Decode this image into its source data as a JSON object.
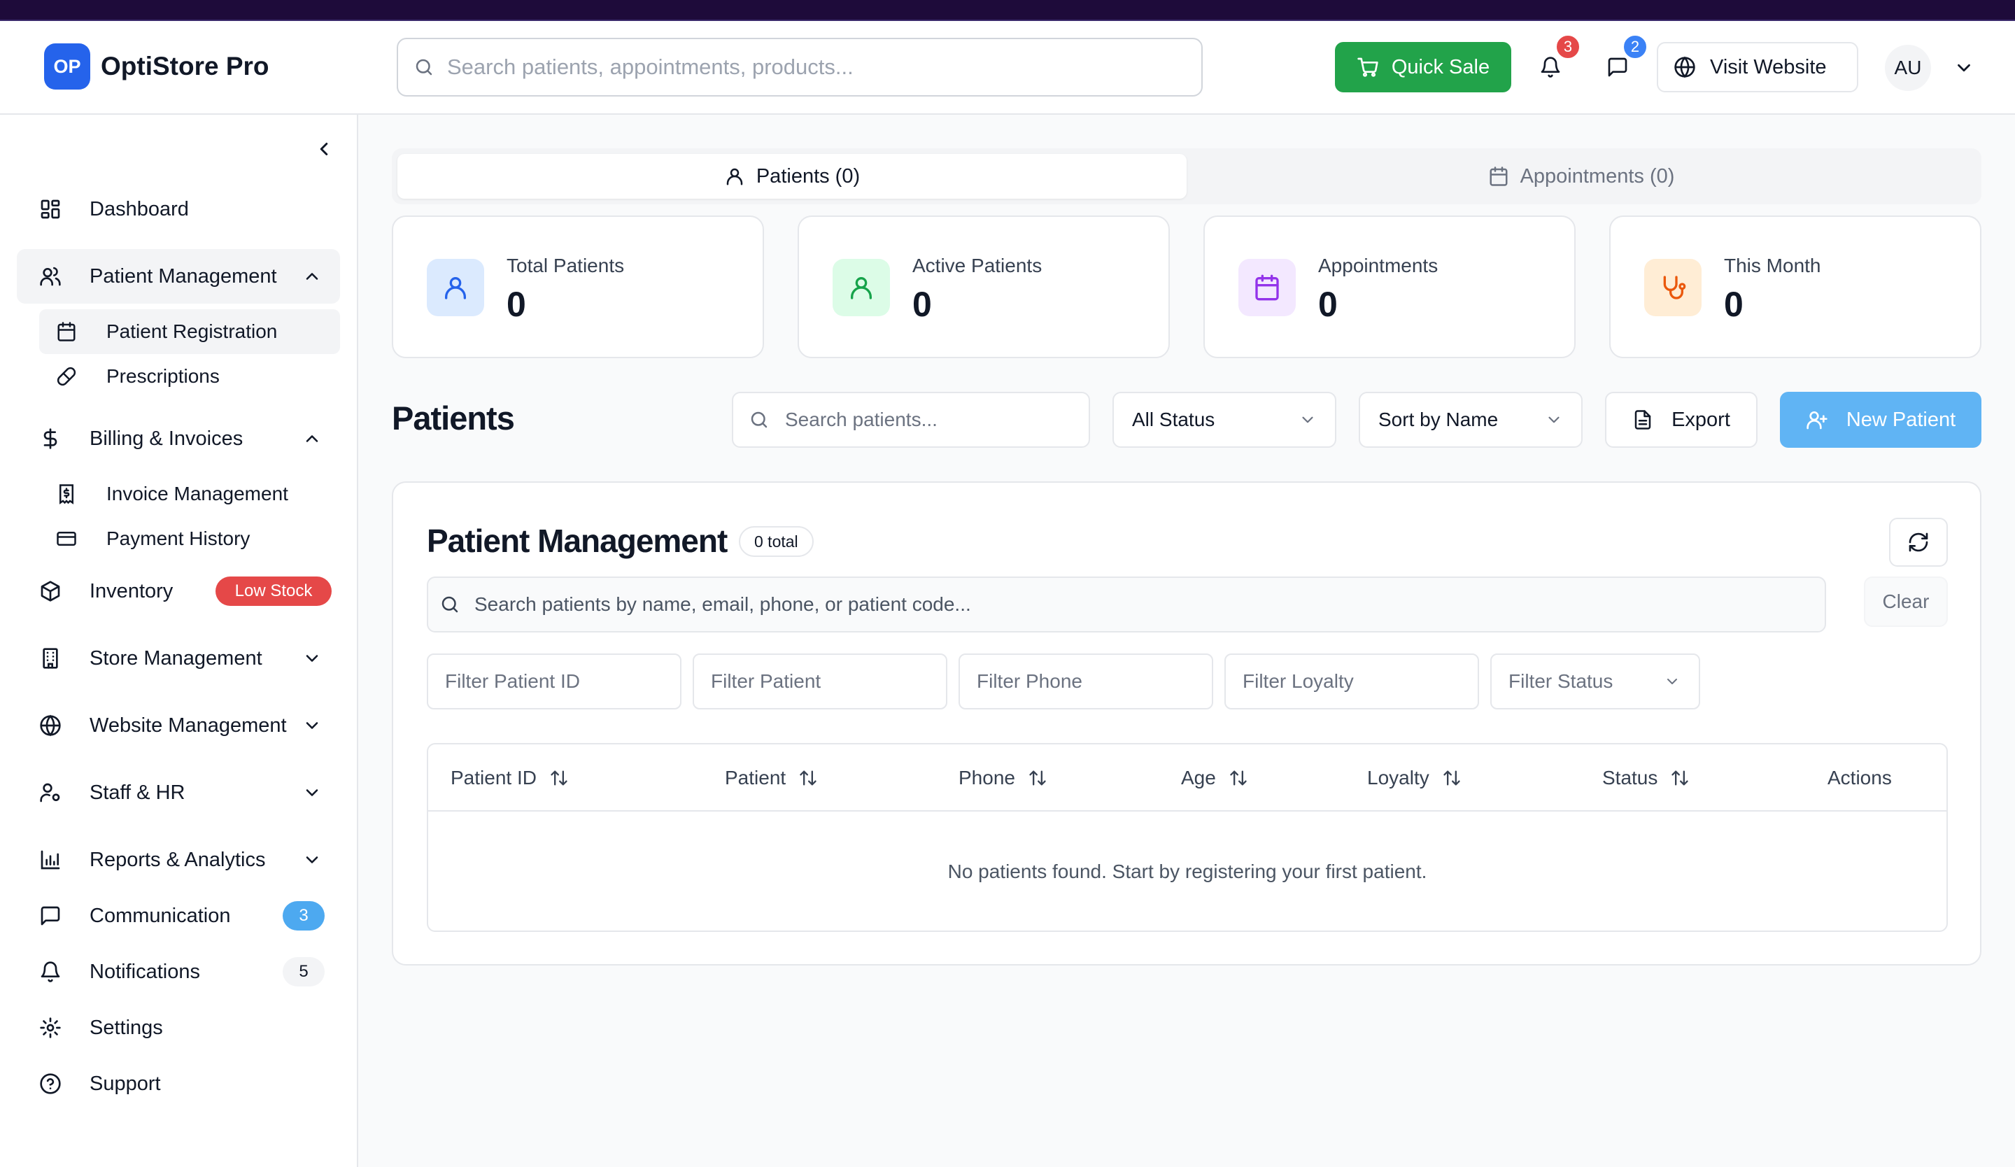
{
  "app": {
    "logo_initials": "OP",
    "name": "OptiStore Pro"
  },
  "header": {
    "search_placeholder": "Search patients, appointments, products...",
    "quick_sale_label": "Quick Sale",
    "notifications_count": "3",
    "messages_count": "2",
    "visit_website_label": "Visit Website",
    "user_initials": "AU"
  },
  "sidebar": {
    "dashboard": "Dashboard",
    "patient_management": "Patient Management",
    "patient_registration": "Patient Registration",
    "prescriptions": "Prescriptions",
    "billing": "Billing & Invoices",
    "invoice_management": "Invoice Management",
    "payment_history": "Payment History",
    "inventory": "Inventory",
    "inventory_badge": "Low Stock",
    "store_management": "Store Management",
    "website_management": "Website Management",
    "staff_hr": "Staff & HR",
    "reports": "Reports & Analytics",
    "communication": "Communication",
    "communication_badge": "3",
    "notifications": "Notifications",
    "notifications_badge": "5",
    "settings": "Settings",
    "support": "Support"
  },
  "tabs": {
    "patients": "Patients (0)",
    "appointments": "Appointments (0)"
  },
  "stats": [
    {
      "label": "Total Patients",
      "value": "0"
    },
    {
      "label": "Active Patients",
      "value": "0"
    },
    {
      "label": "Appointments",
      "value": "0"
    },
    {
      "label": "This Month",
      "value": "0"
    }
  ],
  "toolbar": {
    "title": "Patients",
    "search_placeholder": "Search patients...",
    "status_filter": "All Status",
    "sort": "Sort by Name",
    "export_label": "Export",
    "new_patient_label": "New Patient"
  },
  "management": {
    "title": "Patient Management",
    "total_badge": "0 total",
    "search_placeholder": "Search patients by name, email, phone, or patient code...",
    "clear_label": "Clear",
    "filters": {
      "patient_id": "Filter Patient ID",
      "patient": "Filter Patient",
      "phone": "Filter Phone",
      "loyalty": "Filter Loyalty",
      "status": "Filter Status"
    },
    "columns": [
      "Patient ID",
      "Patient",
      "Phone",
      "Age",
      "Loyalty",
      "Status",
      "Actions"
    ],
    "empty_message": "No patients found. Start by registering your first patient."
  },
  "colors": {
    "brand": "#2563eb",
    "quick_sale": "#22a34a",
    "new_patient": "#60b4f4",
    "low_stock": "#e54848",
    "communication_badge": "#4da9f0"
  }
}
